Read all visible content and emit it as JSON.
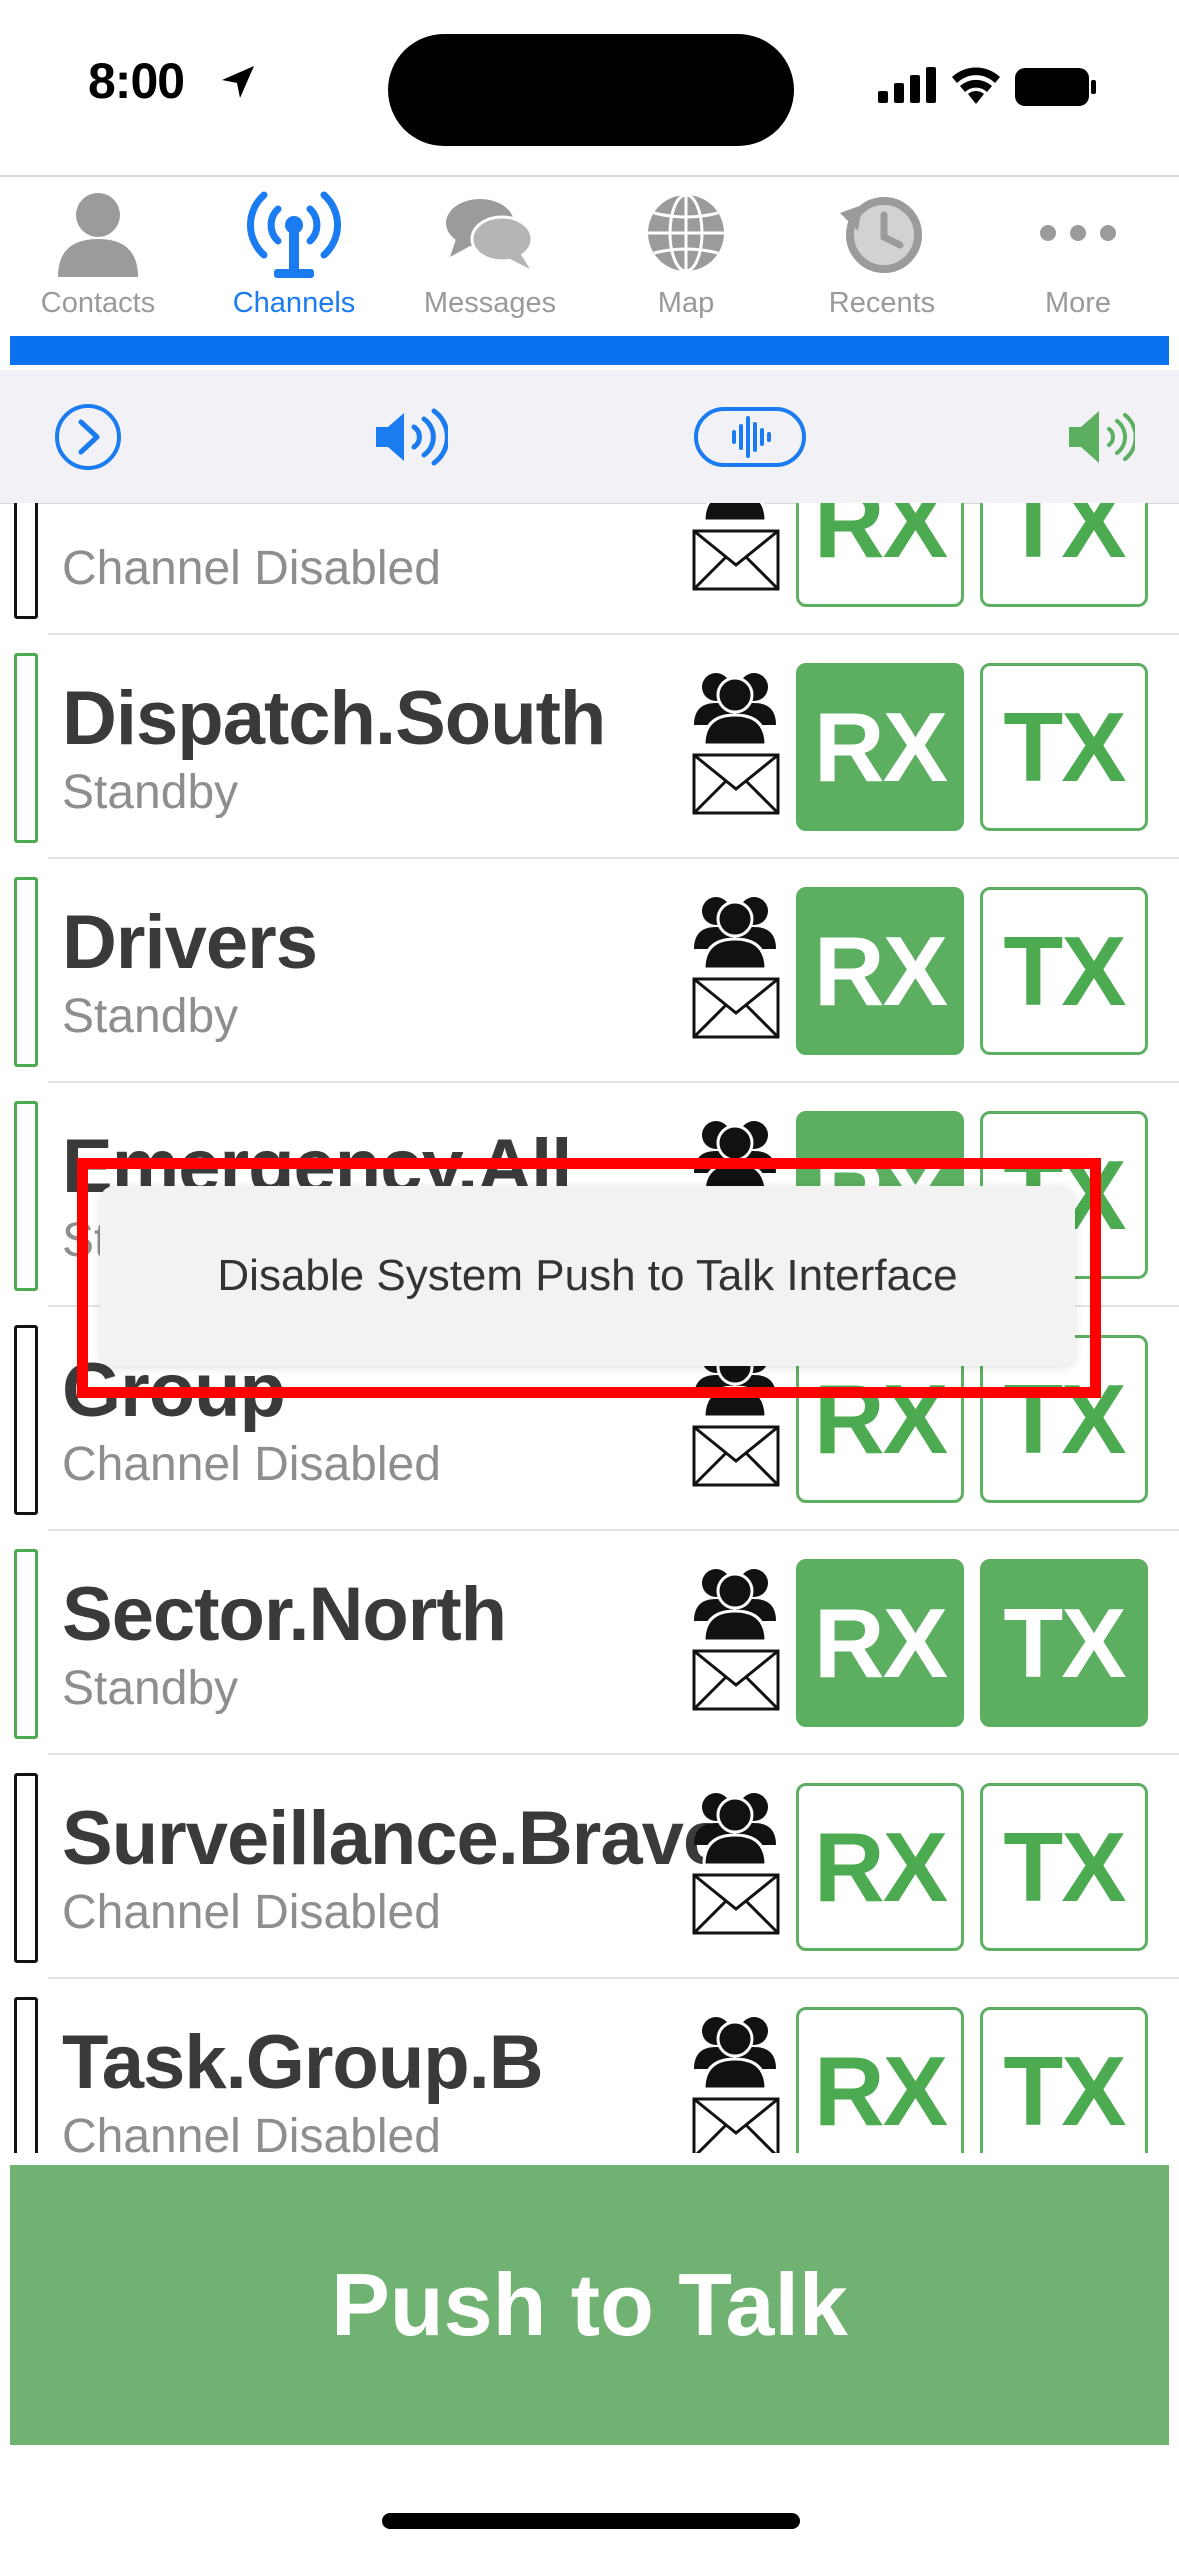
{
  "status_bar": {
    "time": "8:00"
  },
  "tabs": [
    {
      "label": "Contacts",
      "icon": "person-icon",
      "active": false
    },
    {
      "label": "Channels",
      "icon": "antenna-icon",
      "active": true
    },
    {
      "label": "Messages",
      "icon": "chat-bubbles-icon",
      "active": false
    },
    {
      "label": "Map",
      "icon": "globe-icon",
      "active": false
    },
    {
      "label": "Recents",
      "icon": "history-icon",
      "active": false
    },
    {
      "label": "More",
      "icon": "ellipsis-icon",
      "active": false
    }
  ],
  "toolbar": {
    "icons": [
      "chevron-right-circle-icon",
      "speaker-wave-icon",
      "voice-waveform-icon",
      "speaker-volume-icon"
    ]
  },
  "channels": [
    {
      "name": "",
      "status": "Channel Disabled",
      "active": false,
      "rx_on": false,
      "tx_on": false
    },
    {
      "name": "Dispatch.South",
      "status": "Standby",
      "active": true,
      "rx_on": true,
      "tx_on": false
    },
    {
      "name": "Drivers",
      "status": "Standby",
      "active": true,
      "rx_on": true,
      "tx_on": false
    },
    {
      "name": "Emergency.All",
      "status": "Standby",
      "active": true,
      "rx_on": true,
      "tx_on": false
    },
    {
      "name": "Group",
      "status": "Channel Disabled",
      "active": false,
      "rx_on": false,
      "tx_on": false
    },
    {
      "name": "Sector.North",
      "status": "Standby",
      "active": true,
      "rx_on": true,
      "tx_on": true
    },
    {
      "name": "Surveillance.Bravo",
      "status": "Channel Disabled",
      "active": false,
      "rx_on": false,
      "tx_on": false
    },
    {
      "name": "Task.Group.B",
      "status": "Channel Disabled",
      "active": false,
      "rx_on": false,
      "tx_on": false
    }
  ],
  "chip_labels": {
    "rx": "RX",
    "tx": "TX"
  },
  "alert": {
    "text": "Disable System Push to Talk Interface"
  },
  "ptt_button": {
    "label": "Push to Talk"
  },
  "colors": {
    "accent_blue": "#0a72ee",
    "green": "#5cae60",
    "highlight_red": "#ff0000"
  }
}
